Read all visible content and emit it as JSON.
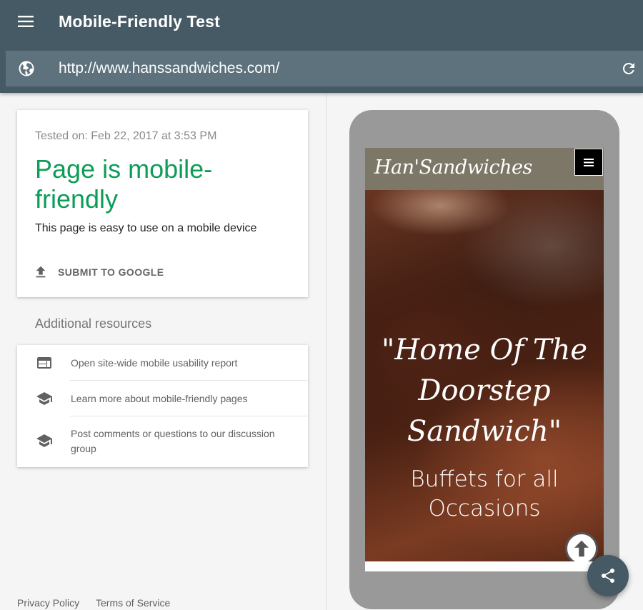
{
  "header": {
    "menu_icon": "menu-icon",
    "title": "Mobile-Friendly Test"
  },
  "urlbar": {
    "globe_icon": "globe-icon",
    "url": "http://www.hanssandwiches.com/",
    "reload_icon": "reload-icon"
  },
  "result": {
    "tested_on": "Tested on: Feb 22, 2017 at 3:53 PM",
    "verdict": "Page is mobile-friendly",
    "subtitle": "This page is easy to use on a mobile device",
    "submit_icon": "upload-icon",
    "submit_label": "SUBMIT TO GOOGLE",
    "verdict_color": "#0d9d58"
  },
  "resources": {
    "heading": "Additional resources",
    "items": [
      {
        "icon": "web-report-icon",
        "label": "Open site-wide mobile usability report"
      },
      {
        "icon": "school-icon",
        "label": "Learn more about mobile-friendly pages"
      },
      {
        "icon": "school-icon",
        "label": "Post comments or questions to our discussion group"
      }
    ]
  },
  "footer": {
    "privacy": "Privacy Policy",
    "terms": "Terms of Service"
  },
  "preview": {
    "site_logo": "Han'Sandwiches",
    "site_menu_icon": "hamburger-icon",
    "hero_quote": "\"Home Of The Doorstep Sandwich\"",
    "hero_sub": "Buffets for all Occasions",
    "scroll_top_icon": "arrow-up-icon"
  },
  "fab": {
    "icon": "share-icon"
  },
  "colors": {
    "toolbar": "#455a64",
    "urlbar": "#5d727d",
    "accent_green": "#0d9d58",
    "phone_frame": "#999999"
  }
}
